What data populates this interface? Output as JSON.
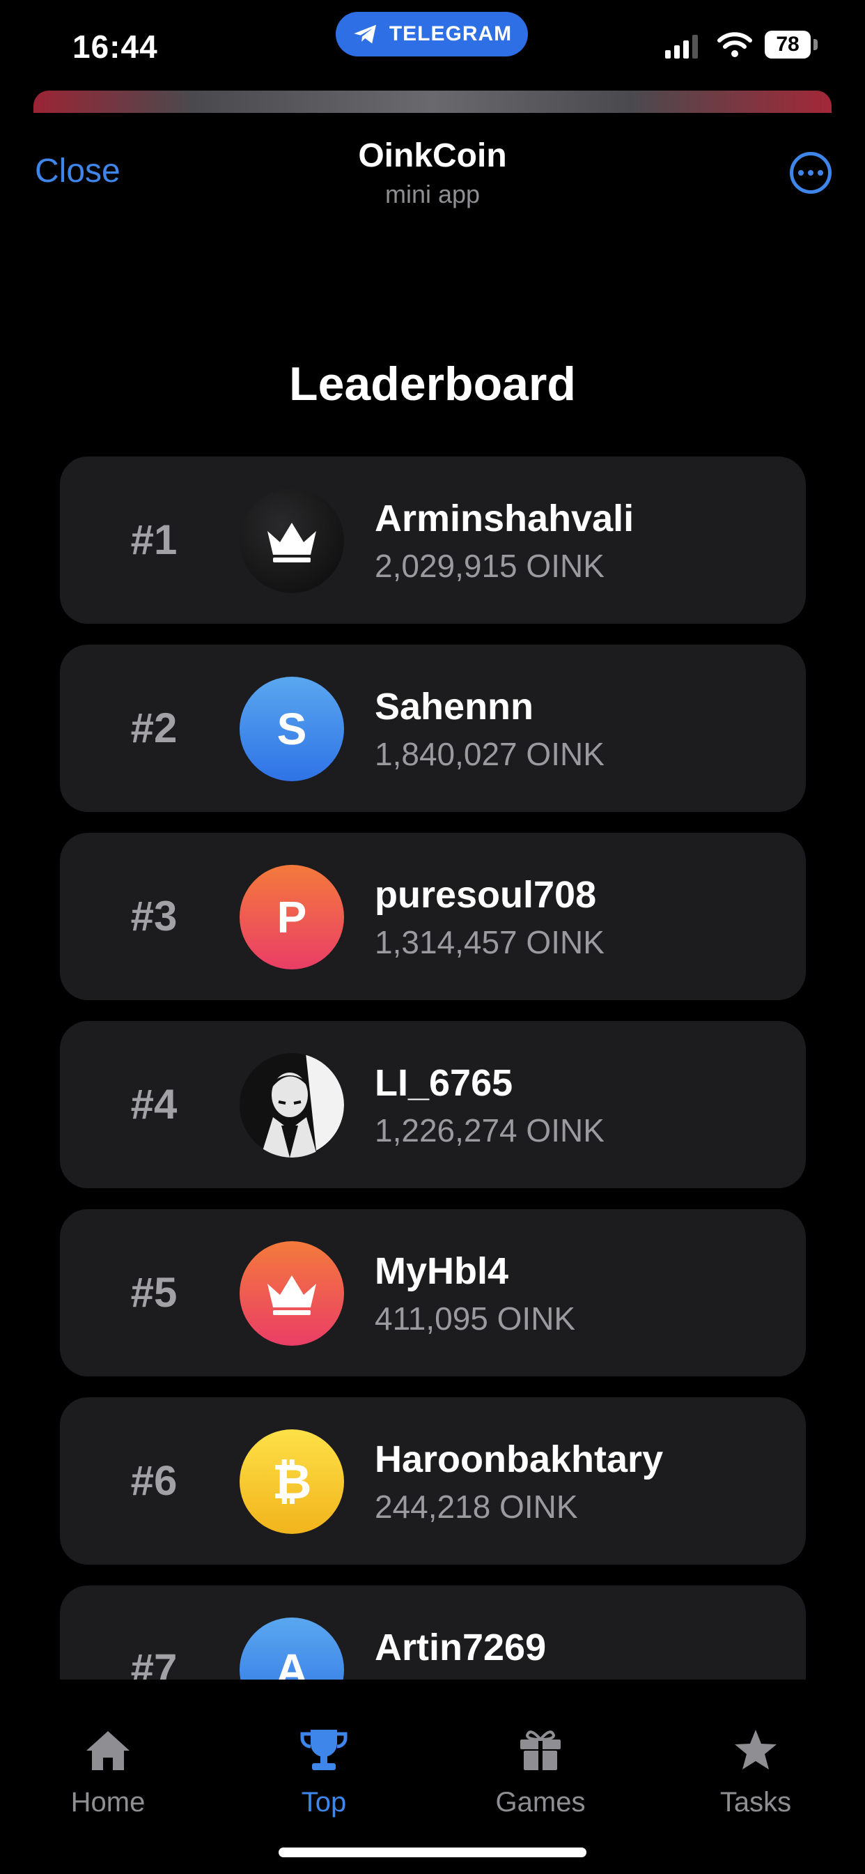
{
  "status": {
    "time": "16:44",
    "pill": "TELEGRAM",
    "battery": "78"
  },
  "header": {
    "close": "Close",
    "title": "OinkCoin",
    "subtitle": "mini app"
  },
  "page_title": "Leaderboard",
  "leaderboard": [
    {
      "rank": "#1",
      "name": "Arminshahvali",
      "score": "2,029,915 OINK",
      "avatar": "crown-icon"
    },
    {
      "rank": "#2",
      "name": "Sahennn",
      "score": "1,840,027 OINK",
      "avatar": "S"
    },
    {
      "rank": "#3",
      "name": "puresoul708",
      "score": "1,314,457 OINK",
      "avatar": "P"
    },
    {
      "rank": "#4",
      "name": "LI_6765",
      "score": "1,226,274 OINK",
      "avatar": "photo"
    },
    {
      "rank": "#5",
      "name": "MyHbl4",
      "score": "411,095 OINK",
      "avatar": "crown-icon"
    },
    {
      "rank": "#6",
      "name": "Haroonbakhtary",
      "score": "244,218 OINK",
      "avatar": "bitcoin-icon"
    },
    {
      "rank": "#7",
      "name": "Artin7269",
      "score": "",
      "avatar": "A"
    }
  ],
  "tabs": [
    {
      "label": "Home",
      "icon": "home-icon",
      "active": false
    },
    {
      "label": "Top",
      "icon": "trophy-icon",
      "active": true
    },
    {
      "label": "Games",
      "icon": "gift-icon",
      "active": false
    },
    {
      "label": "Tasks",
      "icon": "star-icon",
      "active": false
    }
  ],
  "colors": {
    "accent": "#3f86ea",
    "card": "#1c1c1e",
    "background": "#000000"
  }
}
